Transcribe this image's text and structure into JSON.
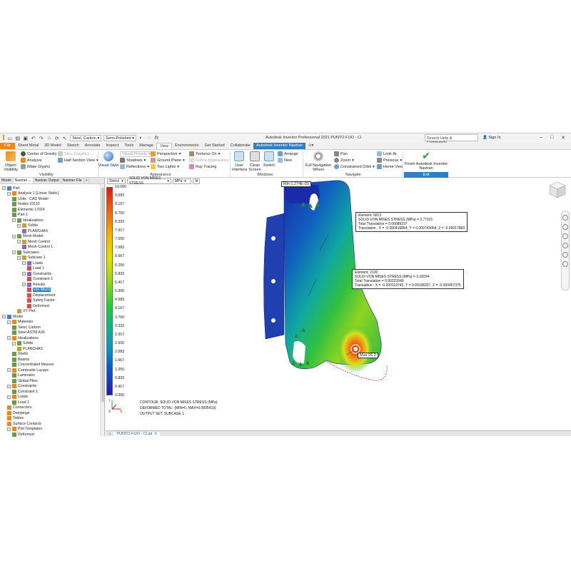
{
  "titlebar": {
    "material": "Steel, Carbon",
    "appearance": "Semi-Polished",
    "title": "Autodesk Inventor Professional 2021   PUNTO FIJO - Cl",
    "search_placeholder": "Search Help & Commands...",
    "signin": "Sign In"
  },
  "tabs": [
    "File",
    "Sheet Metal",
    "3D Model",
    "Sketch",
    "Annotate",
    "Inspect",
    "Tools",
    "Manage",
    "View",
    "Environments",
    "Get Started",
    "Collaborate",
    "Autodesk Inventor Nastran"
  ],
  "active_tab": "View",
  "ribbon": {
    "object_visibility": "Object Visibility",
    "center_of_gravity": "Center of Gravity",
    "analysis": "Analysis",
    "ivmate_glyphs": "iMate Glyphs",
    "slice_graphics": "Slice Graphics",
    "half_section_view": "Half Section View",
    "visibility_panel": "Visibility",
    "visual_style": "Visual Style",
    "visual_preset": "Visual Presets",
    "shadows": "Shadows",
    "reflections": "Reflections",
    "perspective": "Perspective",
    "ground_plane": "Ground Plane",
    "two_lights": "Two Lights",
    "textures_on": "Textures On",
    "refine_appearance": "Refine Appearance",
    "ray_tracing": "Ray Tracing",
    "appearance_panel": "Appearance",
    "user_interface": "User Interface",
    "clean_screen": "Clean Screen",
    "switch": "Switch",
    "arrange": "Arrange",
    "new": "New",
    "windows_panel": "Windows",
    "full_nav_wheel": "Full Navigation Wheel",
    "pan": "Pan",
    "zoom": "Zoom",
    "constrained_orbit": "Constrained Orbit",
    "look_at": "Look At",
    "previous": "Previous",
    "home_view": "Home View",
    "navigate_panel": "Navigate",
    "finish": "Finish Autodesk Inventor Nastran",
    "exit_panel": "Exit"
  },
  "browser": {
    "tabs": [
      "Model",
      "Nastran ...",
      "Nastran Output",
      "Nastran File",
      "+"
    ],
    "items": [
      {
        "label": "Part",
        "level": 0
      },
      {
        "label": "Analysis 1 [Linear Static]",
        "level": 1
      },
      {
        "label": "Units : CAD Model",
        "level": 2
      },
      {
        "label": "Nodes 33110",
        "level": 2
      },
      {
        "label": "Elements 17024",
        "level": 2
      },
      {
        "label": "Part 1",
        "level": 2
      },
      {
        "label": "Idealizations",
        "level": 2
      },
      {
        "label": "Solids",
        "level": 3
      },
      {
        "label": "PLANCHAS",
        "level": 4
      },
      {
        "label": "Mesh Model",
        "level": 2
      },
      {
        "label": "Mesh Control",
        "level": 3
      },
      {
        "label": "Mesh Control 1",
        "level": 4
      },
      {
        "label": "Subcases",
        "level": 2
      },
      {
        "label": "Subcase 1",
        "level": 3
      },
      {
        "label": "Loads",
        "level": 4
      },
      {
        "label": "Load 1",
        "level": 5
      },
      {
        "label": "Constraints",
        "level": 4
      },
      {
        "label": "Constraint 1",
        "level": 5
      },
      {
        "label": "Results",
        "level": 4
      },
      {
        "label": "von Mises",
        "level": 5
      },
      {
        "label": "Displacement",
        "level": 5
      },
      {
        "label": "Safety Factor",
        "level": 5
      },
      {
        "label": "Deformed",
        "level": 5
      },
      {
        "label": "XY Plot",
        "level": 3
      },
      {
        "label": "Model",
        "level": 0
      },
      {
        "label": "Materials",
        "level": 1
      },
      {
        "label": "Steel, Carbon",
        "level": 2
      },
      {
        "label": "Steel ASTM A36",
        "level": 2
      },
      {
        "label": "Idealizations",
        "level": 1
      },
      {
        "label": "Solids",
        "level": 2
      },
      {
        "label": "PLANCHAS",
        "level": 3
      },
      {
        "label": "Shells",
        "level": 2
      },
      {
        "label": "Beams",
        "level": 2
      },
      {
        "label": "Concentrated Masses",
        "level": 2
      },
      {
        "label": "Composite Layups",
        "level": 1
      },
      {
        "label": "Laminates",
        "level": 2
      },
      {
        "label": "Global Plies",
        "level": 2
      },
      {
        "label": "Constraints",
        "level": 1
      },
      {
        "label": "Constraint 1",
        "level": 2
      },
      {
        "label": "Loads",
        "level": 1
      },
      {
        "label": "Load 1",
        "level": 2
      },
      {
        "label": "Connectors",
        "level": 1
      },
      {
        "label": "Dampings",
        "level": 1
      },
      {
        "label": "Tables",
        "level": 1
      },
      {
        "label": "Surface Contacts",
        "level": 1
      },
      {
        "label": "Plot Templates",
        "level": 1
      },
      {
        "label": "Deformed",
        "level": 2
      }
    ],
    "selected_index": 19
  },
  "viewport": {
    "result_type": "Stress",
    "result_component": "SOLID VON MISES STRESS",
    "units": "MPa",
    "legend": [
      "10.000",
      "9.583",
      "9.167",
      "8.750",
      "8.333",
      "7.917",
      "7.500",
      "7.083",
      "6.667",
      "6.250",
      "5.833",
      "5.417",
      "5.000",
      "4.583",
      "4.167",
      "3.750",
      "3.333",
      "2.917",
      "2.500",
      "2.083",
      "1.667",
      "1.250",
      "0.833",
      "0.417",
      "0.000"
    ],
    "contour_lines": [
      "CONTOUR: SOLID VON MISES STRESS (MPa)",
      "DEFORMED TOTAL: (MIN=0, MAX=0.0005419)",
      "OUTPUT SET: SUBCASE 1"
    ],
    "min_label": "Min:1.274E-03",
    "max_label": "Max:26.3",
    "callout1": [
      "Element: 5813",
      "SOLID VON MISES STRESS (MPa) = 2.77115",
      "Total Translation = 0.00089197",
      "Translation : X = -0.000416864, Y = 0.000743064, Z = -0.00017883"
    ],
    "callout2": [
      "Element: 2130",
      "SOLID VON MISES STRESS (MPa) = 3.18294",
      "Total Translation = 0.00223349",
      "Translation : X = -0.000119745, Y = 0.00198327, Z = -0.000457375"
    ]
  },
  "doctabs": [
    "PUNTO FIJO - Cl.ipt",
    "X"
  ]
}
